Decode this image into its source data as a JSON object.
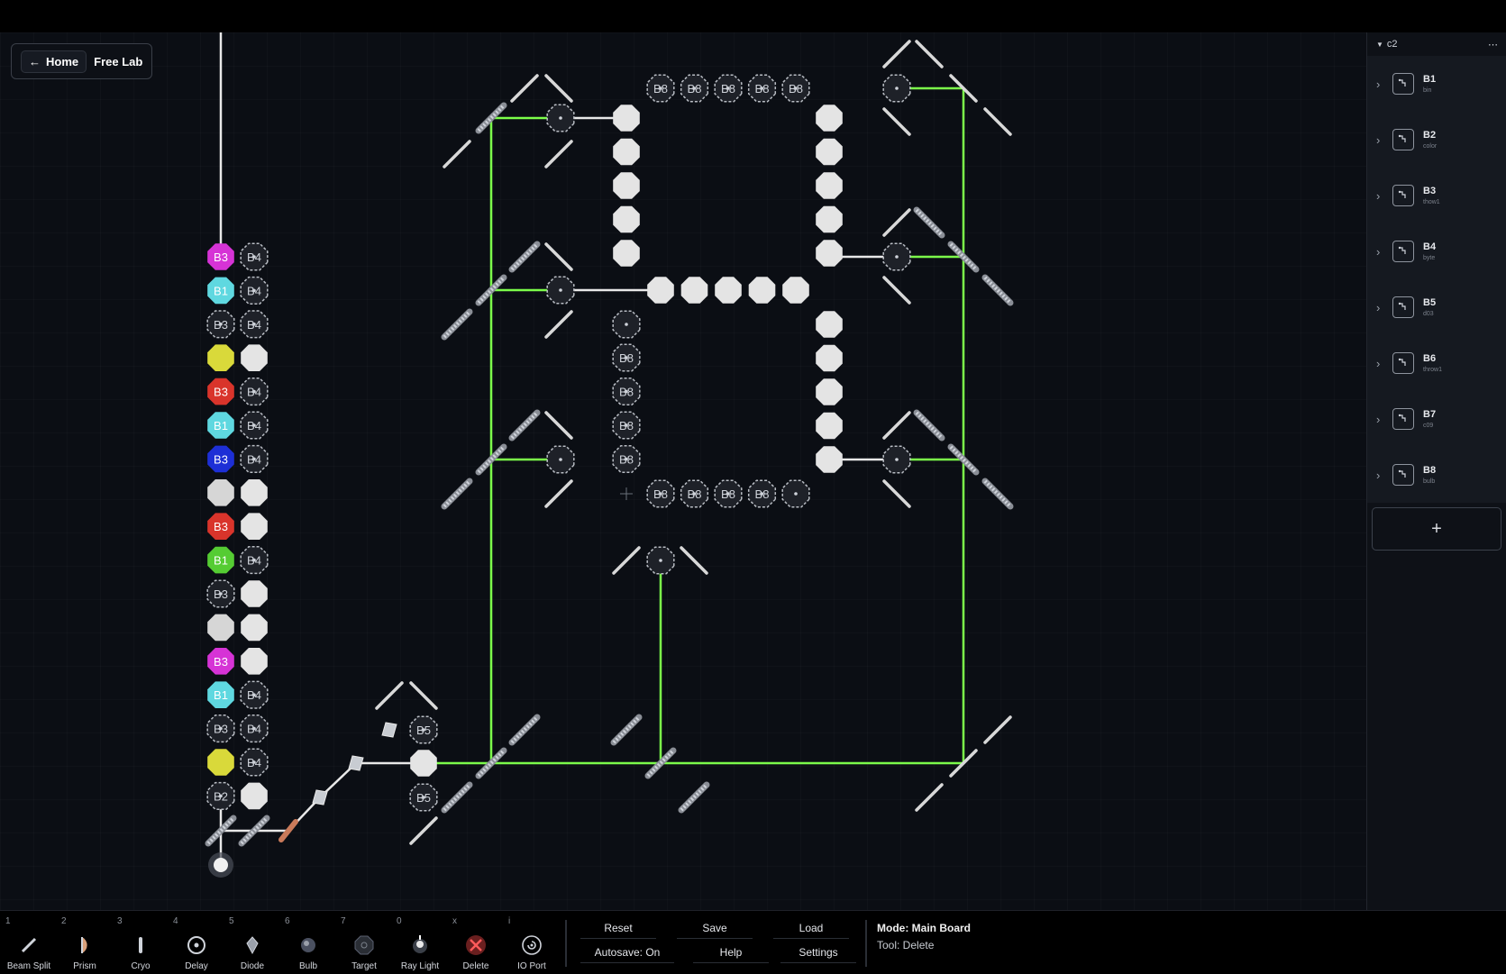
{
  "nav": {
    "home_label": "Home",
    "breadcrumb": "Free Lab",
    "back_icon": "arrow-left-icon"
  },
  "sidebar": {
    "header": "c2",
    "items": [
      {
        "name": "B1",
        "sub": "bin"
      },
      {
        "name": "B2",
        "sub": "color"
      },
      {
        "name": "B3",
        "sub": "thow1"
      },
      {
        "name": "B4",
        "sub": "byte"
      },
      {
        "name": "B5",
        "sub": "d03"
      },
      {
        "name": "B6",
        "sub": "throw1"
      },
      {
        "name": "B7",
        "sub": "c09"
      },
      {
        "name": "B8",
        "sub": "bulb"
      }
    ],
    "add_label": "+"
  },
  "toolbar": {
    "tools": [
      {
        "key": "1",
        "label": "Beam Split",
        "icon": "beam-split-icon"
      },
      {
        "key": "2",
        "label": "Prism",
        "icon": "prism-icon"
      },
      {
        "key": "3",
        "label": "Cryo",
        "icon": "cryo-icon"
      },
      {
        "key": "4",
        "label": "Delay",
        "icon": "delay-icon"
      },
      {
        "key": "5",
        "label": "Diode",
        "icon": "diode-icon"
      },
      {
        "key": "6",
        "label": "Bulb",
        "icon": "bulb-icon"
      },
      {
        "key": "7",
        "label": "Target",
        "icon": "target-icon"
      },
      {
        "key": "0",
        "label": "Ray Light",
        "icon": "ray-light-icon"
      },
      {
        "key": "x",
        "label": "Delete",
        "icon": "delete-icon"
      },
      {
        "key": "i",
        "label": "IO Port",
        "icon": "io-port-icon"
      }
    ],
    "actions": {
      "reset": "Reset",
      "save": "Save",
      "load": "Load",
      "autosave": "Autosave: On",
      "help": "Help",
      "settings": "Settings"
    }
  },
  "status": {
    "mode": "Mode: Main Board",
    "tool": "Tool: Delete"
  },
  "board": {
    "beam_color": "#7cff4a",
    "column": [
      {
        "left": {
          "label": "B3",
          "color": "#d633d6"
        },
        "right": "B4"
      },
      {
        "left": {
          "label": "B1",
          "color": "#5fd8e0"
        },
        "right": "B4"
      },
      {
        "left": {
          "label": "B3",
          "color": ""
        },
        "right": "B4"
      },
      {
        "left": {
          "label": "",
          "color": "#d9d93a"
        },
        "right": ""
      },
      {
        "left": {
          "label": "B3",
          "color": "#d9342b"
        },
        "right": "B4"
      },
      {
        "left": {
          "label": "B1",
          "color": "#5fd8e0"
        },
        "right": "B4"
      },
      {
        "left": {
          "label": "B3",
          "color": "#1d2fd6"
        },
        "right": "B4"
      },
      {
        "left": {
          "label": "",
          "color": "#d6d6d6"
        },
        "right": ""
      },
      {
        "left": {
          "label": "B3",
          "color": "#d9342b"
        },
        "right": ""
      },
      {
        "left": {
          "label": "B1",
          "color": "#55cc33"
        },
        "right": "B4"
      },
      {
        "left": {
          "label": "B3",
          "color": ""
        },
        "right": ""
      },
      {
        "left": {
          "label": "",
          "color": "#d6d6d6"
        },
        "right": ""
      },
      {
        "left": {
          "label": "B3",
          "color": "#d633d6"
        },
        "right": ""
      },
      {
        "left": {
          "label": "B1",
          "color": "#5fd8e0"
        },
        "right": "B4"
      },
      {
        "left": {
          "label": "B3",
          "color": ""
        },
        "right": "B4"
      },
      {
        "left": {
          "label": "",
          "color": "#d9d93a"
        },
        "right": "B4"
      },
      {
        "left": {
          "label": "B2",
          "color": ""
        },
        "right": ""
      }
    ],
    "b5_labels": [
      "B5",
      "B5"
    ],
    "b8_label": "B8"
  }
}
